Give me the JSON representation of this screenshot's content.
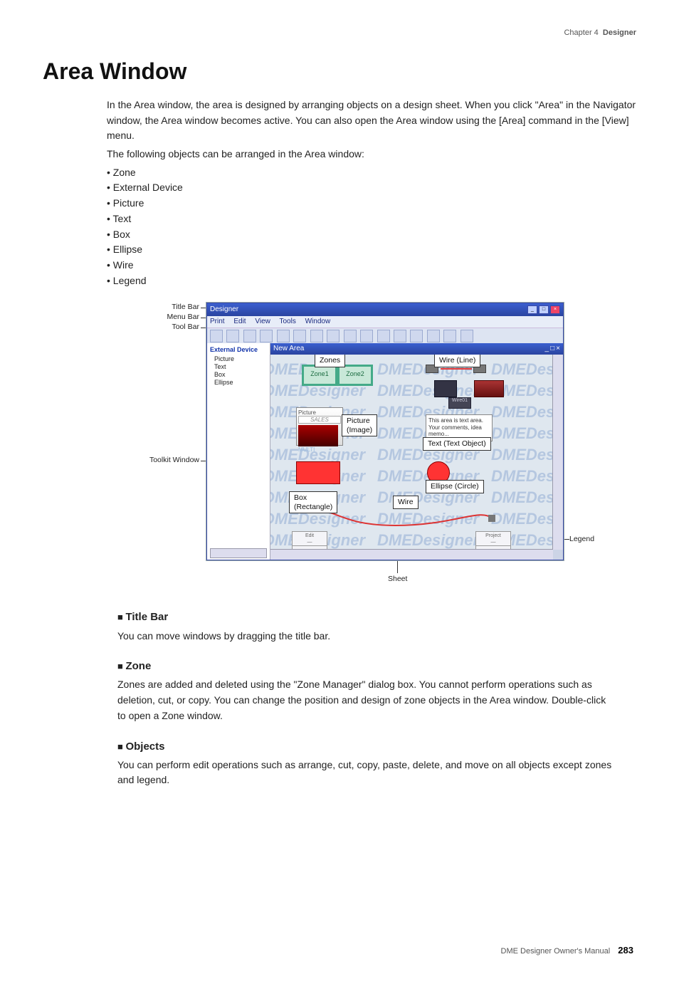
{
  "header": {
    "chapter": "Chapter 4",
    "section": "Designer"
  },
  "heading": "Area Window",
  "intro": {
    "p1": "In the Area window, the area is designed by arranging objects on a design sheet. When you click \"Area\" in the Navigator window, the Area window becomes active. You can also open the Area window using the [Area] command in the [View] menu.",
    "p2": "The following objects can be arranged in the Area window:",
    "items": [
      "Zone",
      "External Device",
      "Picture",
      "Text",
      "Box",
      "Ellipse",
      "Wire",
      "Legend"
    ]
  },
  "figure_labels": {
    "title_bar": "Title Bar",
    "menu_bar": "Menu Bar",
    "tool_bar": "Tool Bar",
    "toolkit_window": "Toolkit Window",
    "legend": "Legend",
    "sheet": "Sheet"
  },
  "window": {
    "title": "Designer",
    "menu": [
      "Print",
      "Edit",
      "View",
      "Tools",
      "Window"
    ],
    "toolkit_header": "External Device",
    "toolkit_items": [
      "Picture",
      "Text",
      "Box",
      "Ellipse"
    ],
    "canvas_title": "New Area",
    "watermark": "DMEDesigner",
    "zone1": "Zone1",
    "zone2": "Zone2",
    "picture_label": "Picture",
    "multi_label": "MULTI",
    "text_sample1": "This area is text area.",
    "text_sample2": "Your comments, idea memo...",
    "wire_label": "Wire01",
    "sales_label": "SALES",
    "legend_tl": "Edit",
    "legend_tr": "Project"
  },
  "callouts": {
    "zones": "Zones",
    "wire_line": "Wire (Line)",
    "picture_image": "Picture\n(Image)",
    "text_object": "Text (Text Object)",
    "ellipse": "Ellipse (Circle)",
    "box": "Box\n(Rectangle)",
    "wire": "Wire"
  },
  "sections": {
    "title_bar": {
      "h": "Title Bar",
      "p": "You can move windows by dragging the title bar."
    },
    "zone": {
      "h": "Zone",
      "p": "Zones are added and deleted using the \"Zone Manager\" dialog box. You cannot perform operations such as deletion, cut, or copy. You can change the position and design of zone objects in the Area window. Double-click to open a Zone window."
    },
    "objects": {
      "h": "Objects",
      "p": "You can perform edit operations such as arrange, cut, copy, paste, delete, and move on all objects except zones and legend."
    }
  },
  "footer": {
    "text": "DME Designer Owner's Manual",
    "page": "283"
  }
}
